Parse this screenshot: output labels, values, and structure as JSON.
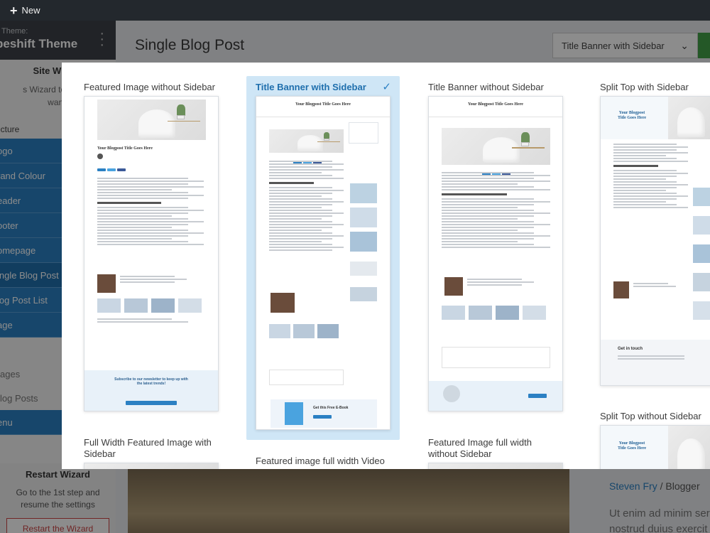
{
  "topbar": {
    "new_label": "New"
  },
  "sidebar": {
    "theme_small": "nt Theme:",
    "theme_name": "peshift Theme",
    "wizard_title": "Site Wizard",
    "wizard_desc_1": "s Wizard to design",
    "wizard_desc_2": "want.",
    "section_label": "ucture",
    "items": [
      {
        "label": "ogo"
      },
      {
        "label": "rand Colour"
      },
      {
        "label": "eader"
      },
      {
        "label": "ooter"
      },
      {
        "label": "omepage"
      },
      {
        "label": "ingle Blog Post"
      },
      {
        "label": "log Post List"
      },
      {
        "label": "age"
      }
    ],
    "grey_items": [
      {
        "label": "ages"
      },
      {
        "label": "log Posts"
      }
    ],
    "menu_label": "enu",
    "restart_title": "Restart Wizard",
    "restart_desc_1": "Go to the 1st step and",
    "restart_desc_2": "resume the settings",
    "restart_button": "Restart the Wizard"
  },
  "main": {
    "title": "Single Blog Post",
    "select_value": "Title Banner with Sidebar",
    "author_name": "Steven Fry",
    "author_sep": " / ",
    "author_role": "Blogger",
    "lorem_1": "Ut enim ad minim ser",
    "lorem_2": "nostrud duius exercit"
  },
  "modal": {
    "cards": [
      {
        "title": "Featured Image without Sidebar"
      },
      {
        "title": "Title Banner with Sidebar"
      },
      {
        "title": "Title Banner without Sidebar"
      },
      {
        "title": "Split Top with Sidebar"
      },
      {
        "title": "Full Width Featured Image with Sidebar"
      },
      {
        "title": "Featured image full width Video"
      },
      {
        "title": "Featured Image full width without Sidebar"
      },
      {
        "title": "Split Top without Sidebar"
      }
    ],
    "thumb_text": {
      "post_title": "Your Blogpost Title Goes Here",
      "split_title_1": "Your Blogpost",
      "split_title_2": "Title Goes Here",
      "newsletter": "Subscribe to our newsletter to keep up with the latest trends!",
      "get_book": "Get this Free E-Book",
      "get_in_touch": "Get in touch"
    }
  },
  "colors": {
    "accent": "#2b80c3",
    "selected_bg": "#cfe6f6",
    "admin_bar": "#23282d"
  }
}
